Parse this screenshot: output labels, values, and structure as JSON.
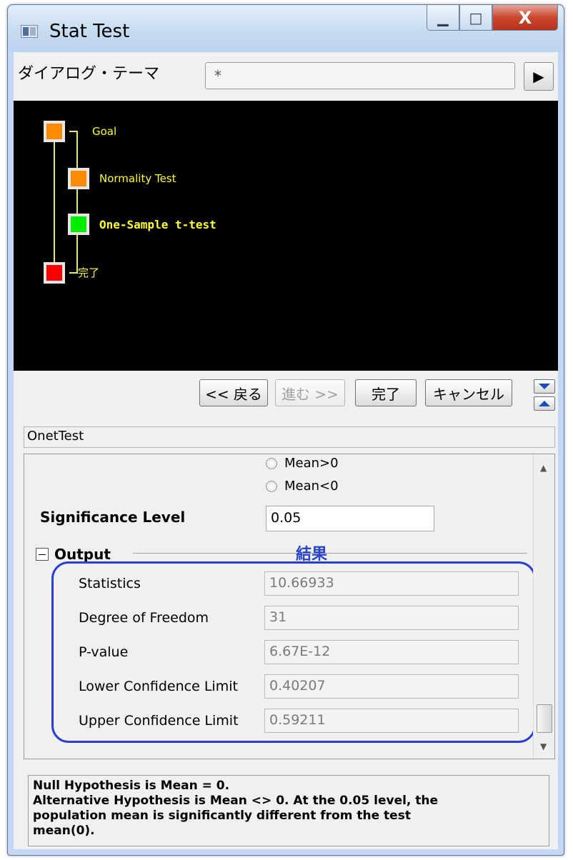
{
  "window": {
    "title": "Stat Test",
    "minimize_label": "▁",
    "maximize_label": "□",
    "close_label": "X"
  },
  "theme": {
    "label": "ダイアログ・テーマ",
    "value": "*",
    "arrow_label": "▶"
  },
  "flowchart": {
    "nodes": [
      {
        "label": "Goal",
        "color": "#ff8c00"
      },
      {
        "label": "Normality Test",
        "color": "#ff8c00"
      },
      {
        "label": "One-Sample t-test",
        "color": "#00ee00"
      },
      {
        "label": "完了",
        "color": "#ff0000"
      }
    ],
    "line_color": "#e8e85a",
    "label_color": "#ffff33"
  },
  "nav": {
    "back": "<< 戻る",
    "next": "進む >>",
    "finish": "完了",
    "cancel": "キャンセル"
  },
  "dialog_name": "OnetTest",
  "panel": {
    "radio_mean_gt": "Mean>0",
    "radio_mean_lt": "Mean<0",
    "significance_label": "Significance Level",
    "significance_value": "0.05",
    "output_label": "Output",
    "annotation": "結果",
    "results": [
      {
        "label": "Statistics",
        "value": "10.66933"
      },
      {
        "label": "Degree of Freedom",
        "value": "31"
      },
      {
        "label": "P-value",
        "value": "6.67E-12"
      },
      {
        "label": "Lower Confidence Limit",
        "value": "0.40207"
      },
      {
        "label": "Upper Confidence Limit",
        "value": "0.59211"
      }
    ]
  },
  "message": {
    "line1": "Null Hypothesis is Mean = 0.",
    "line2": "Alternative Hypothesis is Mean <> 0. At the 0.05 level, the",
    "line3": "population mean is significantly different from the test",
    "line4": "mean(0)."
  },
  "colors": {
    "highlight": "#2a3fd0",
    "annotation": "#2a44c8"
  }
}
